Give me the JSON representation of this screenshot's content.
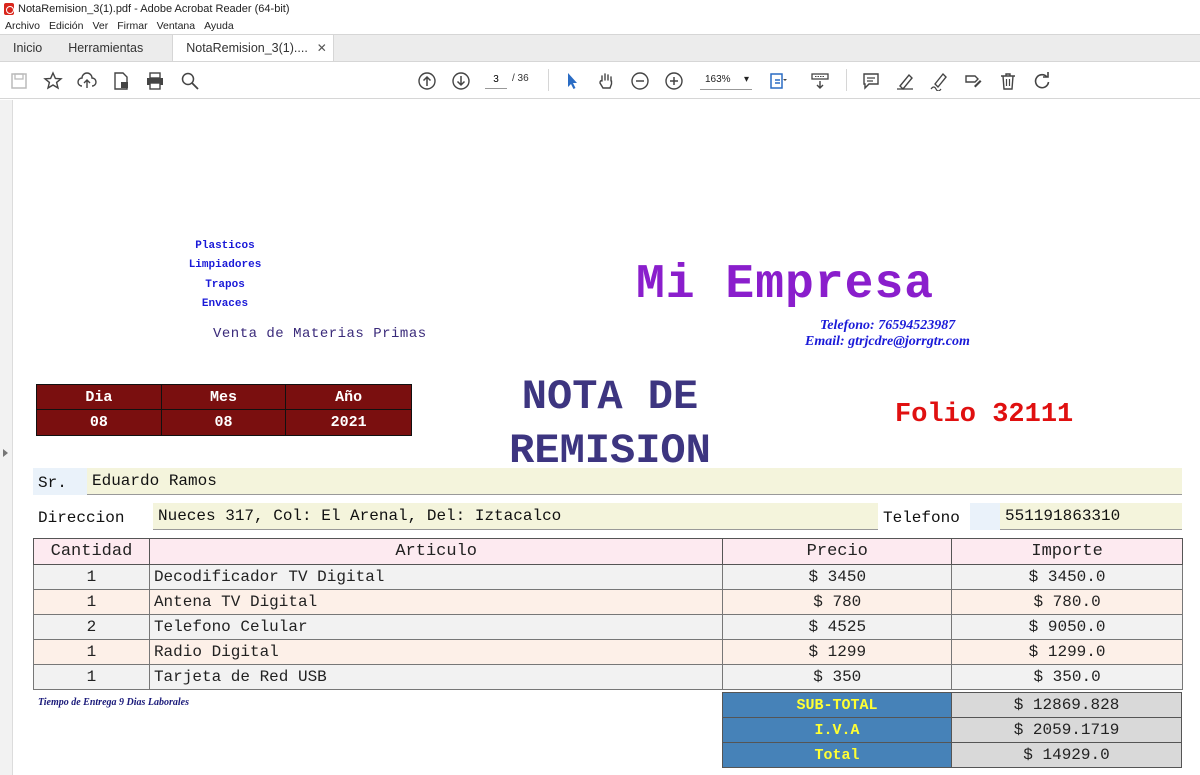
{
  "window": {
    "title": "NotaRemision_3(1).pdf - Adobe Acrobat Reader (64-bit)"
  },
  "menu": [
    "Archivo",
    "Edición",
    "Ver",
    "Firmar",
    "Ventana",
    "Ayuda"
  ],
  "tabs": {
    "home": "Inicio",
    "tools": "Herramientas",
    "document": "NotaRemision_3(1)....",
    "close": "✕"
  },
  "toolbar": {
    "page_current": "3",
    "page_total": "/ 36",
    "zoom": "163%",
    "zoom_arrow": "▾"
  },
  "document": {
    "products": [
      "Plasticos",
      "Limpiadores",
      "Trapos",
      "Envaces"
    ],
    "tagline": "Venta de Materias Primas",
    "company": "Mi Empresa",
    "phone": "Telefono: 76594523987",
    "email": "Email: gtrjcdre@jorrgtr.com",
    "date_headers": [
      "Dia",
      "Mes",
      "Año"
    ],
    "date_values": [
      "08",
      "08",
      "2021"
    ],
    "title_line1": "NOTA DE",
    "title_line2": "REMISION",
    "folio": "Folio 32111",
    "client_label": "Sr.",
    "client_name": "Eduardo Ramos",
    "address_label": "Direccion",
    "address": "Nueces 317, Col: El Arenal, Del: Iztacalco",
    "phone_label": "Telefono",
    "client_phone": "551191863310",
    "columns": [
      "Cantidad",
      "Articulo",
      "Precio",
      "Importe"
    ],
    "rows": [
      {
        "qty": "1",
        "item": "Decodificador TV Digital",
        "price": "$ 3450",
        "amount": "$ 3450.0"
      },
      {
        "qty": "1",
        "item": "Antena TV Digital",
        "price": "$ 780",
        "amount": "$ 780.0"
      },
      {
        "qty": "2",
        "item": "Telefono Celular",
        "price": "$ 4525",
        "amount": "$ 9050.0"
      },
      {
        "qty": "1",
        "item": "Radio Digital",
        "price": "$ 1299",
        "amount": "$ 1299.0"
      },
      {
        "qty": "1",
        "item": "Tarjeta de Red USB",
        "price": "$ 350",
        "amount": "$ 350.0"
      }
    ],
    "delivery_note": "Tiempo de Entrega 9 Dias Laborales",
    "totals": [
      {
        "label": "SUB-TOTAL",
        "value": "$ 12869.828"
      },
      {
        "label": "I.V.A",
        "value": "$ 2059.1719"
      },
      {
        "label": "Total",
        "value": "$ 14929.0"
      }
    ]
  },
  "colors": {
    "company": "#8a1ecc",
    "folio": "#e01010",
    "date_bg": "#7a0f0f",
    "totals_label_bg": "#4682b8"
  }
}
